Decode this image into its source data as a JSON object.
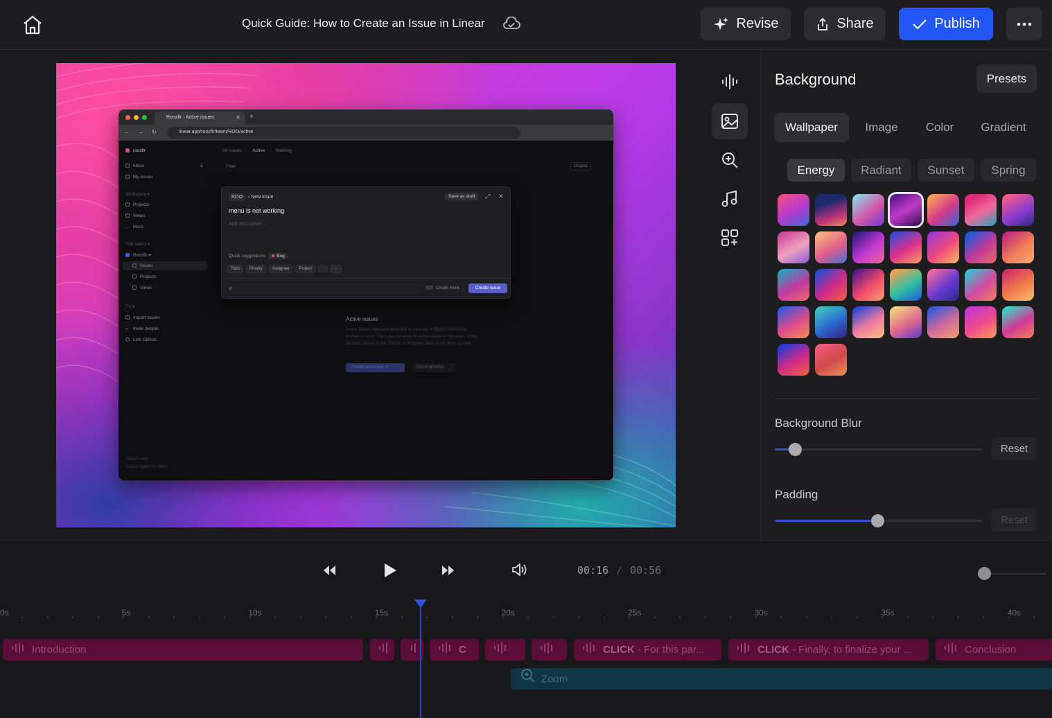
{
  "topbar": {
    "title": "Quick Guide: How to Create an Issue in Linear",
    "revise": "Revise",
    "share": "Share",
    "publish": "Publish"
  },
  "browser": {
    "tab_title": "Roozfir › Active issues",
    "url": "linear.app/roozfir/team/ROO/active",
    "workspace": "roozfir",
    "sidebar": {
      "inbox": "Inbox",
      "inbox_count": "1",
      "my_issues": "My issues",
      "workspace_section": "Workspace ▾",
      "projects": "Projects",
      "views": "Views",
      "more": "More",
      "teams_section": "Your teams ▾",
      "team": "Roozfir ▾",
      "team_issues": "Issues",
      "team_projects": "Projects",
      "team_views": "Views",
      "try_section": "Try ▾",
      "import": "Import issues",
      "invite": "Invite people",
      "github": "Link GitHub",
      "whats_new": "What's new",
      "whats_new_item": "Linear agent for Slack"
    },
    "views": {
      "all": "All issues",
      "active": "Active",
      "backlog": "Backlog"
    },
    "filter": "Filter",
    "display": "Display",
    "empty": {
      "title": "Active issues",
      "desc": "Active issues represent work that is currently in flight or should be worked on next. There are currently no active issues in this team. Once an issue moves to the Todo or In Progress state, it will show up here.",
      "create_btn": "Create new issue",
      "create_key": "C",
      "docs_btn": "Documentation"
    },
    "modal": {
      "team_chip": "ROO",
      "crumb": "New issue",
      "save_draft": "Save as draft",
      "title_value": "menu is not working",
      "desc_placeholder": "Add description...",
      "suggestions": "Quick suggestions",
      "bug": "Bug",
      "props": [
        "Todo",
        "Priority",
        "Assignee",
        "Project",
        "",
        "···"
      ],
      "create_more": "Create more",
      "create_issue": "Create issue"
    }
  },
  "panel": {
    "title": "Background",
    "presets": "Presets",
    "tabs": [
      "Wallpaper",
      "Image",
      "Color",
      "Gradient"
    ],
    "active_tab": "Wallpaper",
    "chips": [
      "Energy",
      "Radiant",
      "Sunset",
      "Spring"
    ],
    "active_chip": "Energy",
    "blur_label": "Background Blur",
    "blur_value": 0.1,
    "padding_label": "Padding",
    "padding_value": 0.5,
    "reset": "Reset"
  },
  "playback": {
    "current": "00:16",
    "separator": "/",
    "total": "00:56",
    "ruler": [
      "0s",
      "5s",
      "10s",
      "15s",
      "20s",
      "25s",
      "30s",
      "35s",
      "40s"
    ],
    "clips": {
      "intro": "Introduction",
      "c": "C",
      "click1_bold": "CLICK",
      "click1_rest": " - For this par...",
      "click2_bold": "CLICK",
      "click2_rest": " - Finally, to finalize your ...",
      "conclusion": "Conclusion"
    },
    "zoom_clip": "Zoom"
  }
}
